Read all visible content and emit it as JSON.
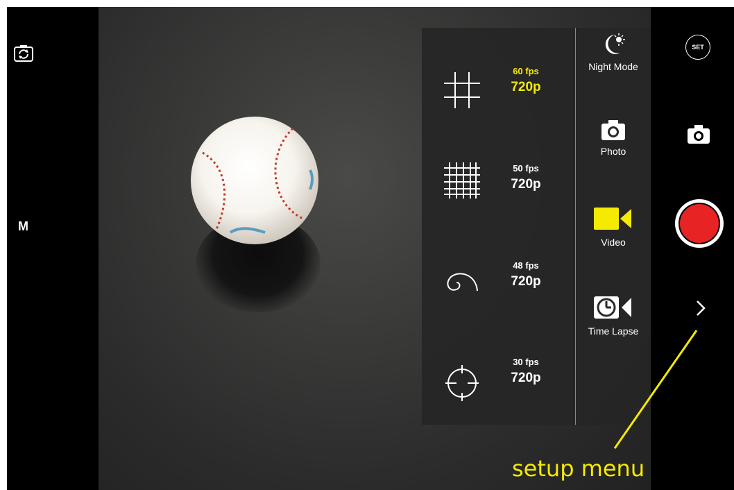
{
  "left_bar": {
    "switch_camera_icon": "camera-switch-icon",
    "mode_label": "M"
  },
  "overlay_menu": {
    "fps_options": [
      {
        "rate": "60 fps",
        "resolution": "720p",
        "selected": true,
        "grid_icon": "grid-3x3-icon"
      },
      {
        "rate": "50 fps",
        "resolution": "720p",
        "selected": false,
        "grid_icon": "grid-dense-icon"
      },
      {
        "rate": "48 fps",
        "resolution": "720p",
        "selected": false,
        "grid_icon": "golden-spiral-icon"
      },
      {
        "rate": "30 fps",
        "resolution": "720p",
        "selected": false,
        "grid_icon": "crosshair-icon"
      }
    ],
    "capture_modes": [
      {
        "label": "Night Mode",
        "icon": "moon-sun-icon",
        "selected": false
      },
      {
        "label": "Photo",
        "icon": "camera-icon",
        "selected": false
      },
      {
        "label": "Video",
        "icon": "video-camera-icon",
        "selected": true
      },
      {
        "label": "Time Lapse",
        "icon": "time-lapse-icon",
        "selected": false
      }
    ]
  },
  "right_bar": {
    "set_label": "SET",
    "photo_icon": "camera-icon",
    "record_icon": "record-button",
    "chevron_icon": "chevron-right-icon"
  },
  "annotation": {
    "text": "setup menu"
  },
  "colors": {
    "accent": "#f5ea00",
    "record": "#e82323",
    "menu_bg": "#262626"
  }
}
